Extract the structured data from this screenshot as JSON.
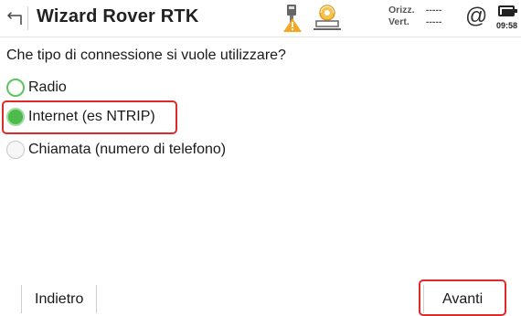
{
  "header": {
    "title": "Wizard Rover RTK",
    "precision": {
      "horizontal_label": "Orizz.",
      "horizontal_value": "-----",
      "vertical_label": "Vert.",
      "vertical_value": "-----"
    },
    "at_symbol": "@",
    "time": "09:58",
    "icons": [
      "back-arrow-icon",
      "gnss-receiver-warning-icon",
      "radio-modem-icon",
      "at-icon",
      "battery-icon"
    ]
  },
  "question": "Che tipo di connessione si vuole utilizzare?",
  "options": [
    {
      "label": "Radio",
      "state": "unselected"
    },
    {
      "label": "Internet (es NTRIP)",
      "state": "selected"
    },
    {
      "label": "Chiamata (numero di telefono)",
      "state": "disabled"
    }
  ],
  "footer": {
    "back_label": "Indietro",
    "next_label": "Avanti"
  },
  "colors": {
    "selected_green": "#4cbb4c",
    "highlight_red": "#e02a2a",
    "warning_orange": "#f5a623"
  }
}
